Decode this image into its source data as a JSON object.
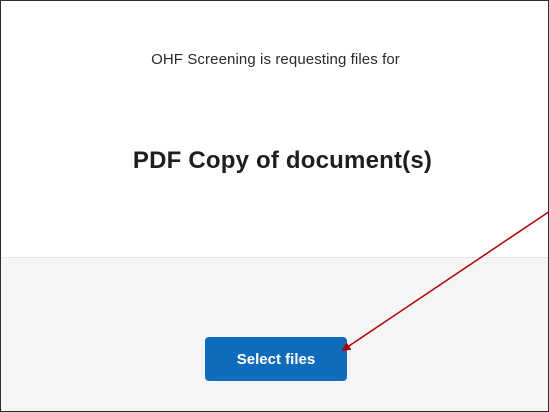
{
  "request": {
    "requester_text": "OHF Screening is requesting files for",
    "document_title": "PDF Copy of document(s)"
  },
  "actions": {
    "select_files_label": "Select files"
  },
  "colors": {
    "primary_button": "#0f6cbd",
    "annotation_arrow": "#b00000",
    "bottom_background": "#f5f5f5"
  },
  "annotation": {
    "icon": "red-arrow-icon"
  }
}
